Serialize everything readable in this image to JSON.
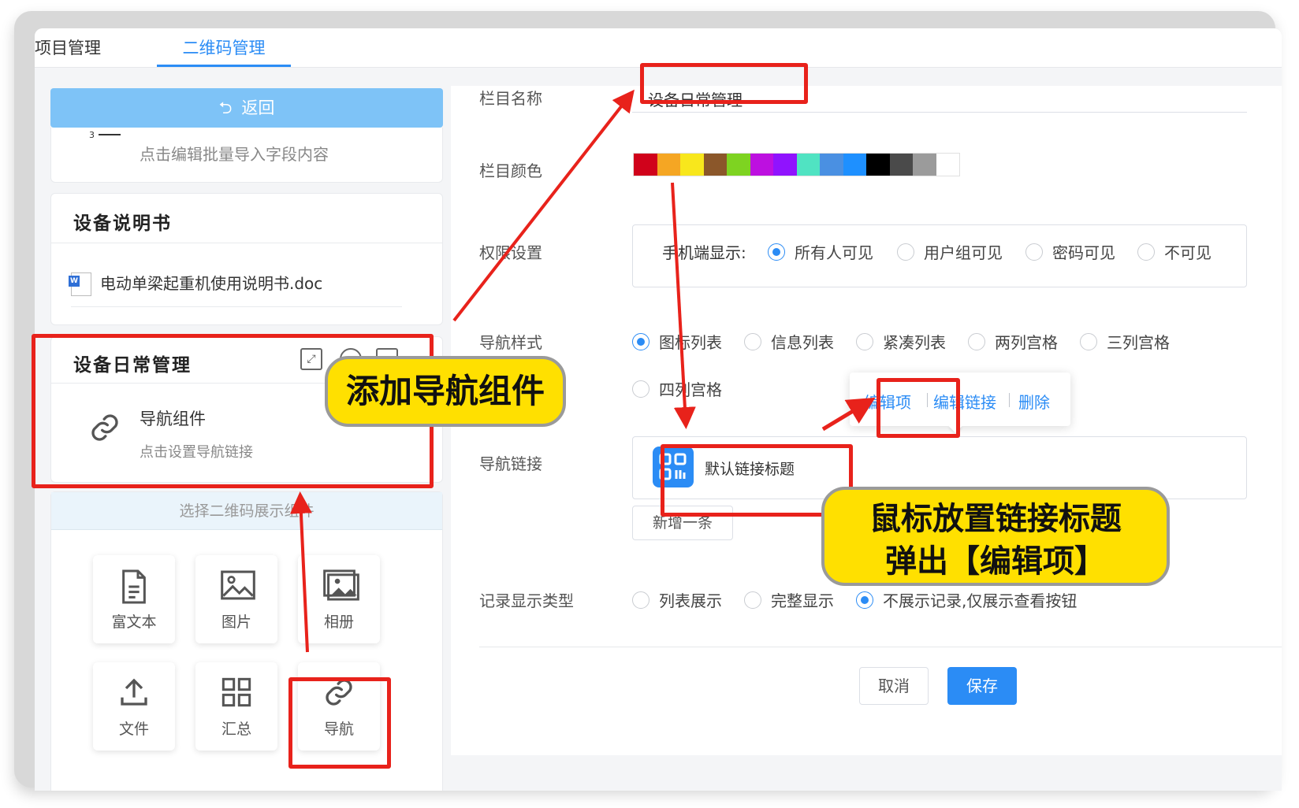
{
  "tabs": [
    {
      "label": "项目管理"
    },
    {
      "label": "二维码管理"
    }
  ],
  "left": {
    "back_label": "返回",
    "batch_card": {
      "number": "3",
      "hint": "点击编辑批量导入字段内容"
    },
    "manual_card": {
      "title": "设备说明书",
      "file_name": "电动单梁起重机使用说明书.doc"
    },
    "daily_card": {
      "title": "设备日常管理",
      "component_name": "导航组件",
      "component_hint": "点击设置导航链接"
    },
    "picker": {
      "header": "选择二维码展示组件",
      "items": [
        {
          "label": "富文本",
          "icon": "document-icon"
        },
        {
          "label": "图片",
          "icon": "image-icon"
        },
        {
          "label": "相册",
          "icon": "album-icon"
        },
        {
          "label": "文件",
          "icon": "upload-icon"
        },
        {
          "label": "汇总",
          "icon": "grid-icon"
        },
        {
          "label": "导航",
          "icon": "link-icon"
        }
      ]
    }
  },
  "form": {
    "name_label": "栏目名称",
    "name_value": "设备日常管理",
    "color_label": "栏目颜色",
    "colors": [
      "#d0021b",
      "#f5a623",
      "#f8e71c",
      "#8b572a",
      "#7ed321",
      "#bd10e0",
      "#9013fe",
      "#50e3c2",
      "#4a90e2",
      "#1e90ff",
      "#000000",
      "#4a4a4a",
      "#9b9b9b",
      "#ffffff"
    ],
    "perm_label": "权限设置",
    "perm_prefix": "手机端显示:",
    "perm_options": [
      "所有人可见",
      "用户组可见",
      "密码可见",
      "不可见"
    ],
    "perm_selected": "所有人可见",
    "nav_style_label": "导航样式",
    "nav_styles": [
      "图标列表",
      "信息列表",
      "紧凑列表",
      "两列宫格",
      "三列宫格",
      "四列宫格"
    ],
    "nav_style_selected": "图标列表",
    "nav_link_label": "导航链接",
    "link_title": "默认链接标题",
    "popover": {
      "edit": "编辑项",
      "edit_link": "编辑链接",
      "delete": "删除"
    },
    "add_label": "新增一条",
    "record_label": "记录显示类型",
    "record_options": [
      "列表展示",
      "完整显示",
      "不展示记录,仅展示查看按钮"
    ],
    "record_selected": "不展示记录,仅展示查看按钮",
    "cancel_label": "取消",
    "save_label": "保存"
  },
  "annotations": {
    "callout_add": "添加导航组件",
    "callout_hover_line1": "鼠标放置链接标题",
    "callout_hover_line2": "弹出【编辑项】",
    "highlight_color": "#e8221b",
    "callout_color": "#ffe000"
  }
}
